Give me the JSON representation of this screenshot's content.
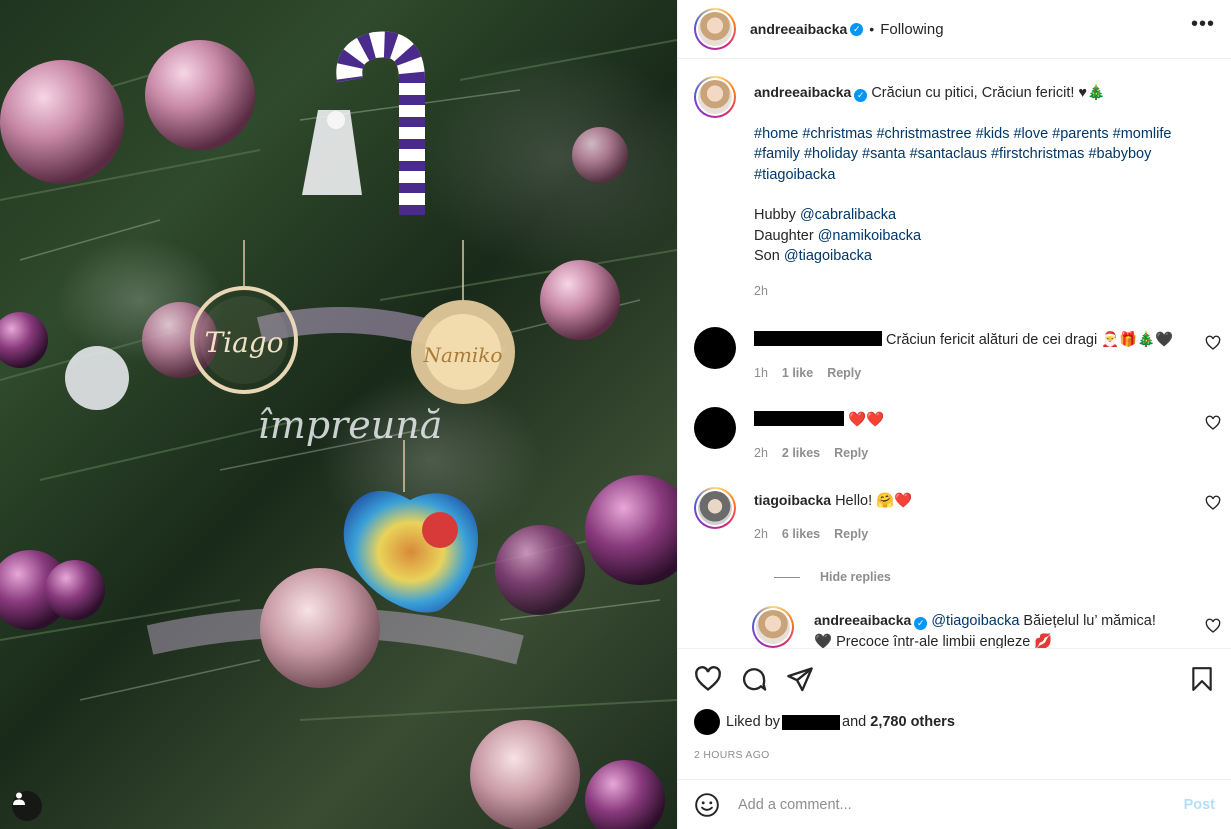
{
  "post": {
    "author": "andreeaibacka",
    "follow_sep": "•",
    "follow_state": "Following",
    "more_label": "•••"
  },
  "caption": {
    "username": "andreeaibacka",
    "text": "Crăciun cu pitici, Crăciun fericit! ♥🎄",
    "hashtags_line1": "#home #christmas #christmastree #kids #love #parents #momlife",
    "hashtags_line2": "#family #holiday #santa #santaclaus #firstchristmas #babyboy",
    "hashtags_line3": "#tiagoibacka",
    "hubby_label": "Hubby ",
    "hubby_handle": "@cabralibacka",
    "daughter_label": "Daughter ",
    "daughter_handle": "@namikoibacka",
    "son_label": "Son ",
    "son_handle": "@tiagoibacka",
    "time": "2h"
  },
  "comments": [
    {
      "text": " Crăciun fericit alături de cei dragi 🎅🎁🎄🖤",
      "time": "1h",
      "likes": "1 like",
      "reply": "Reply"
    },
    {
      "text": "❤️❤️",
      "time": "2h",
      "likes": "2 likes",
      "reply": "Reply"
    },
    {
      "username": "tiagoibacka",
      "text": "Hello! 🤗❤️",
      "time": "2h",
      "likes": "6 likes",
      "reply": "Reply"
    }
  ],
  "hide_replies": "Hide replies",
  "reply": {
    "username": "andreeaibacka",
    "mention": "@tiagoibacka",
    "text": " Băiețelul lu’ mămica!",
    "text2": "🖤 Precoce într-ale limbii engleze 💋"
  },
  "likes": {
    "prefix": "Liked by",
    "and": "and",
    "others": "2,780 others"
  },
  "timestamp": "2 HOURS AGO",
  "comment_box": {
    "placeholder": "Add a comment...",
    "post_label": "Post"
  },
  "colors": {
    "link": "#00376b",
    "verified": "#0095f6",
    "muted": "#8e8e8e",
    "post_disabled": "#b2dffb",
    "heart_red": "#ed4956"
  }
}
